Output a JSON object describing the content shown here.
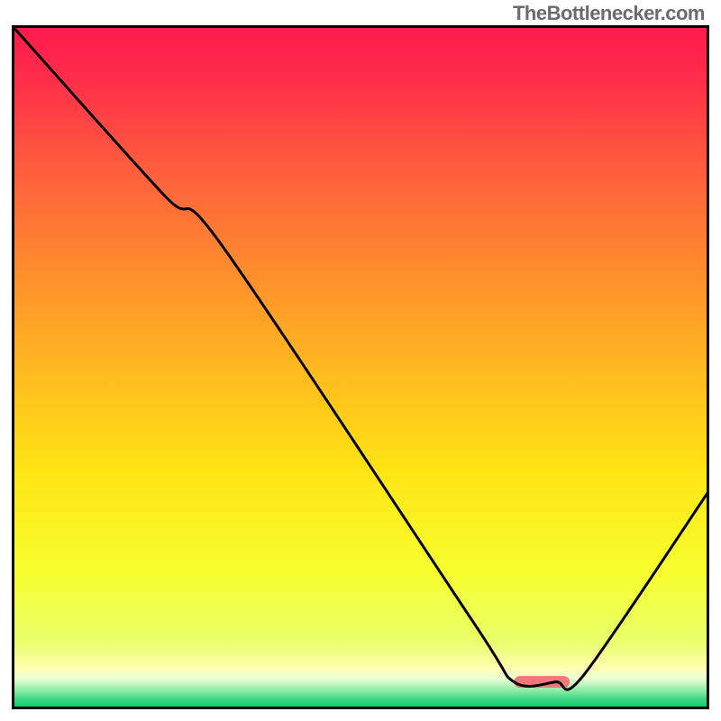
{
  "attribution": "TheBottlenecker.com",
  "chart_data": {
    "type": "line",
    "title": "",
    "xlabel": "",
    "ylabel": "",
    "xlim": [
      0,
      100
    ],
    "ylim": [
      0,
      100
    ],
    "grid": false,
    "series": [
      {
        "name": "curve",
        "x": [
          0,
          22,
          30,
          66,
          72,
          78,
          82,
          100
        ],
        "y": [
          100,
          75,
          68,
          13,
          4,
          4,
          5,
          32
        ],
        "color": "#000000"
      }
    ],
    "marker": {
      "x_start": 72,
      "x_end": 80,
      "y": 4,
      "color": "#f07878"
    },
    "background_gradient": {
      "stops": [
        {
          "offset": 0.0,
          "color": "#ff1a4d"
        },
        {
          "offset": 0.08,
          "color": "#ff2e4a"
        },
        {
          "offset": 0.2,
          "color": "#ff5a3e"
        },
        {
          "offset": 0.35,
          "color": "#ff8a2e"
        },
        {
          "offset": 0.5,
          "color": "#ffb81f"
        },
        {
          "offset": 0.65,
          "color": "#ffe414"
        },
        {
          "offset": 0.8,
          "color": "#f7ff2e"
        },
        {
          "offset": 0.9,
          "color": "#e8ff6a"
        },
        {
          "offset": 0.94,
          "color": "#ffffb0"
        },
        {
          "offset": 0.955,
          "color": "#eaffd4"
        },
        {
          "offset": 0.965,
          "color": "#b8f5bb"
        },
        {
          "offset": 0.975,
          "color": "#7ee8a0"
        },
        {
          "offset": 0.985,
          "color": "#3ed883"
        },
        {
          "offset": 1.0,
          "color": "#00c768"
        }
      ]
    }
  }
}
